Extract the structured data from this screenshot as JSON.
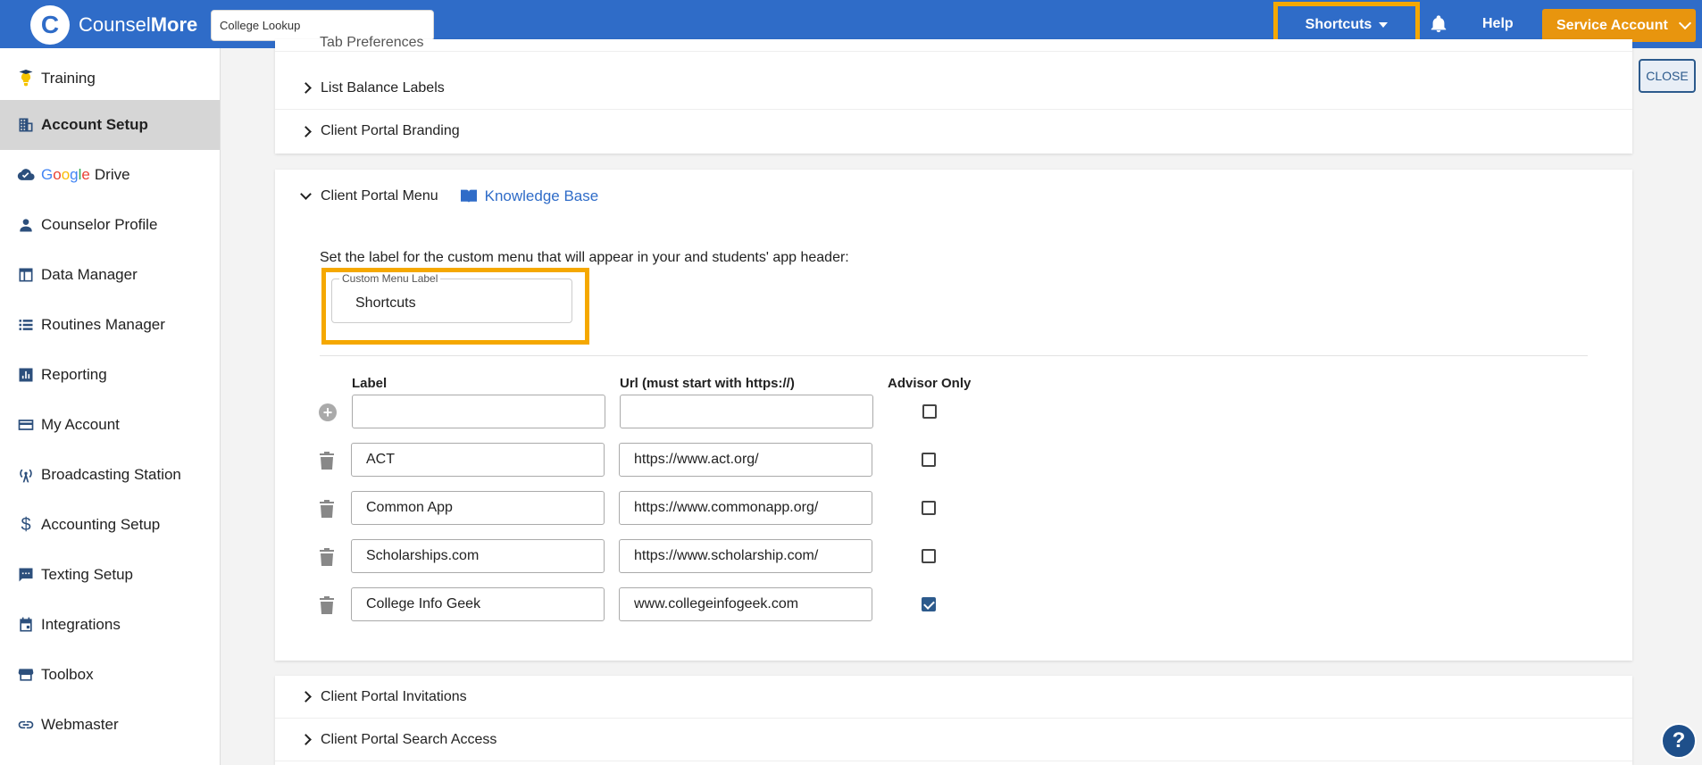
{
  "header": {
    "brand_light": "Counsel",
    "brand_bold": "More",
    "search_value": "College Lookup",
    "shortcuts_label": "Shortcuts",
    "help_label": "Help",
    "account_label": "Service Account"
  },
  "sidebar": {
    "items": [
      {
        "label": "Training",
        "icon": "lightbulb-icon"
      },
      {
        "label": "Account Setup",
        "icon": "building-icon"
      },
      {
        "label": "Drive",
        "icon": "cloud-icon",
        "prefix": "Google"
      },
      {
        "label": "Counselor Profile",
        "icon": "person-icon"
      },
      {
        "label": "Data Manager",
        "icon": "table-icon"
      },
      {
        "label": "Routines Manager",
        "icon": "list-icon"
      },
      {
        "label": "Reporting",
        "icon": "bar-chart-icon"
      },
      {
        "label": "My Account",
        "icon": "credit-card-icon"
      },
      {
        "label": "Broadcasting Station",
        "icon": "antenna-icon"
      },
      {
        "label": "Accounting Setup",
        "icon": "dollar-icon"
      },
      {
        "label": "Texting Setup",
        "icon": "chat-icon"
      },
      {
        "label": "Integrations",
        "icon": "calendar-icon"
      },
      {
        "label": "Toolbox",
        "icon": "toolbox-icon"
      },
      {
        "label": "Webmaster",
        "icon": "link-icon"
      }
    ]
  },
  "sections": {
    "tab_preferences": "Tab Preferences",
    "list_balance_labels": "List Balance Labels",
    "client_portal_branding": "Client Portal Branding",
    "client_portal_menu": "Client Portal Menu",
    "knowledge_base": "Knowledge Base",
    "client_portal_invitations": "Client Portal Invitations",
    "client_portal_search_access": "Client Portal Search Access"
  },
  "menu": {
    "instruction": "Set the label for the custom menu that will appear in your and students' app header:",
    "custom_label_legend": "Custom Menu Label",
    "custom_label_value": "Shortcuts",
    "columns": {
      "label": "Label",
      "url": "Url (must start with https://)",
      "advisor": "Advisor Only"
    },
    "new_row": {
      "label": "",
      "url": "",
      "advisor_only": false
    },
    "rows": [
      {
        "label": "ACT",
        "url": "https://www.act.org/",
        "advisor_only": false
      },
      {
        "label": "Common App",
        "url": "https://www.commonapp.org/",
        "advisor_only": false
      },
      {
        "label": "Scholarships.com",
        "url": "https://www.scholarship.com/",
        "advisor_only": false
      },
      {
        "label": "College Info Geek",
        "url": "www.collegeinfogeek.com",
        "advisor_only": true
      }
    ]
  },
  "close_label": "CLOSE",
  "help_fab": "?"
}
